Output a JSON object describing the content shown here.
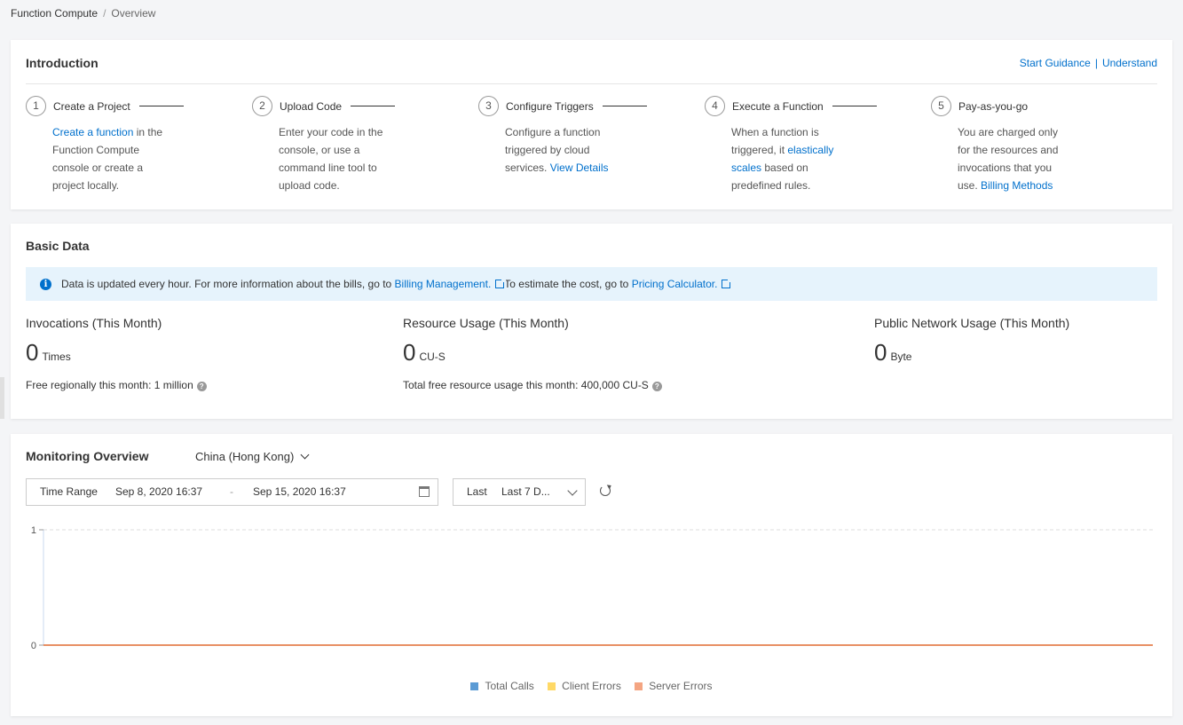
{
  "breadcrumb": {
    "root": "Function Compute",
    "separator": "/",
    "current": "Overview"
  },
  "intro": {
    "title": "Introduction",
    "start_guidance": "Start Guidance",
    "divider": "|",
    "understand": "Understand",
    "steps": [
      {
        "num": "1",
        "title": "Create a Project",
        "link": "Create a function",
        "text_after": " in the Function Compute console or create a project locally."
      },
      {
        "num": "2",
        "title": "Upload Code",
        "text": "Enter your code in the console, or use a command line tool to upload code."
      },
      {
        "num": "3",
        "title": "Configure Triggers",
        "text": "Configure a function triggered by cloud services. ",
        "link": "View Details"
      },
      {
        "num": "4",
        "title": "Execute a Function",
        "text_before": "When a function is triggered, it ",
        "link": "elastically scales",
        "text_after": " based on predefined rules."
      },
      {
        "num": "5",
        "title": "Pay-as-you-go",
        "text": "You are charged only for the resources and invocations that you use. ",
        "link": "Billing Methods"
      }
    ]
  },
  "basic": {
    "title": "Basic Data",
    "notice": {
      "text1": "Data is updated every hour. For more information about the bills, go to ",
      "link1": "Billing Management.",
      "text2": "To estimate the cost, go to ",
      "link2": "Pricing Calculator."
    },
    "metrics": [
      {
        "label": "Invocations (This Month)",
        "value": "0",
        "unit": "Times",
        "note": "Free regionally this month: 1 million"
      },
      {
        "label": "Resource Usage (This Month)",
        "value": "0",
        "unit": "CU-S",
        "note": "Total free resource usage this month: 400,000 CU-S"
      },
      {
        "label": "Public Network Usage (This Month)",
        "value": "0",
        "unit": "Byte",
        "note": ""
      }
    ]
  },
  "monitor": {
    "title": "Monitoring Overview",
    "region": "China (Hong Kong)",
    "time_range_label": "Time Range",
    "start": "Sep 8, 2020 16:37",
    "dash": "-",
    "end": "Sep 15, 2020 16:37",
    "last_label": "Last",
    "last_value": "Last 7 D...",
    "legend": [
      {
        "name": "Total Calls",
        "color": "#5b9bd5"
      },
      {
        "name": "Client Errors",
        "color": "#ffd966"
      },
      {
        "name": "Server Errors",
        "color": "#f4a582"
      }
    ]
  },
  "chart_data": {
    "type": "line",
    "yticks": [
      "1",
      "0"
    ],
    "ylim": [
      0,
      1
    ],
    "series": [
      {
        "name": "Total Calls",
        "values": [
          0,
          0
        ]
      },
      {
        "name": "Client Errors",
        "values": [
          0,
          0
        ]
      },
      {
        "name": "Server Errors",
        "values": [
          0,
          0
        ]
      }
    ],
    "grid": true
  }
}
